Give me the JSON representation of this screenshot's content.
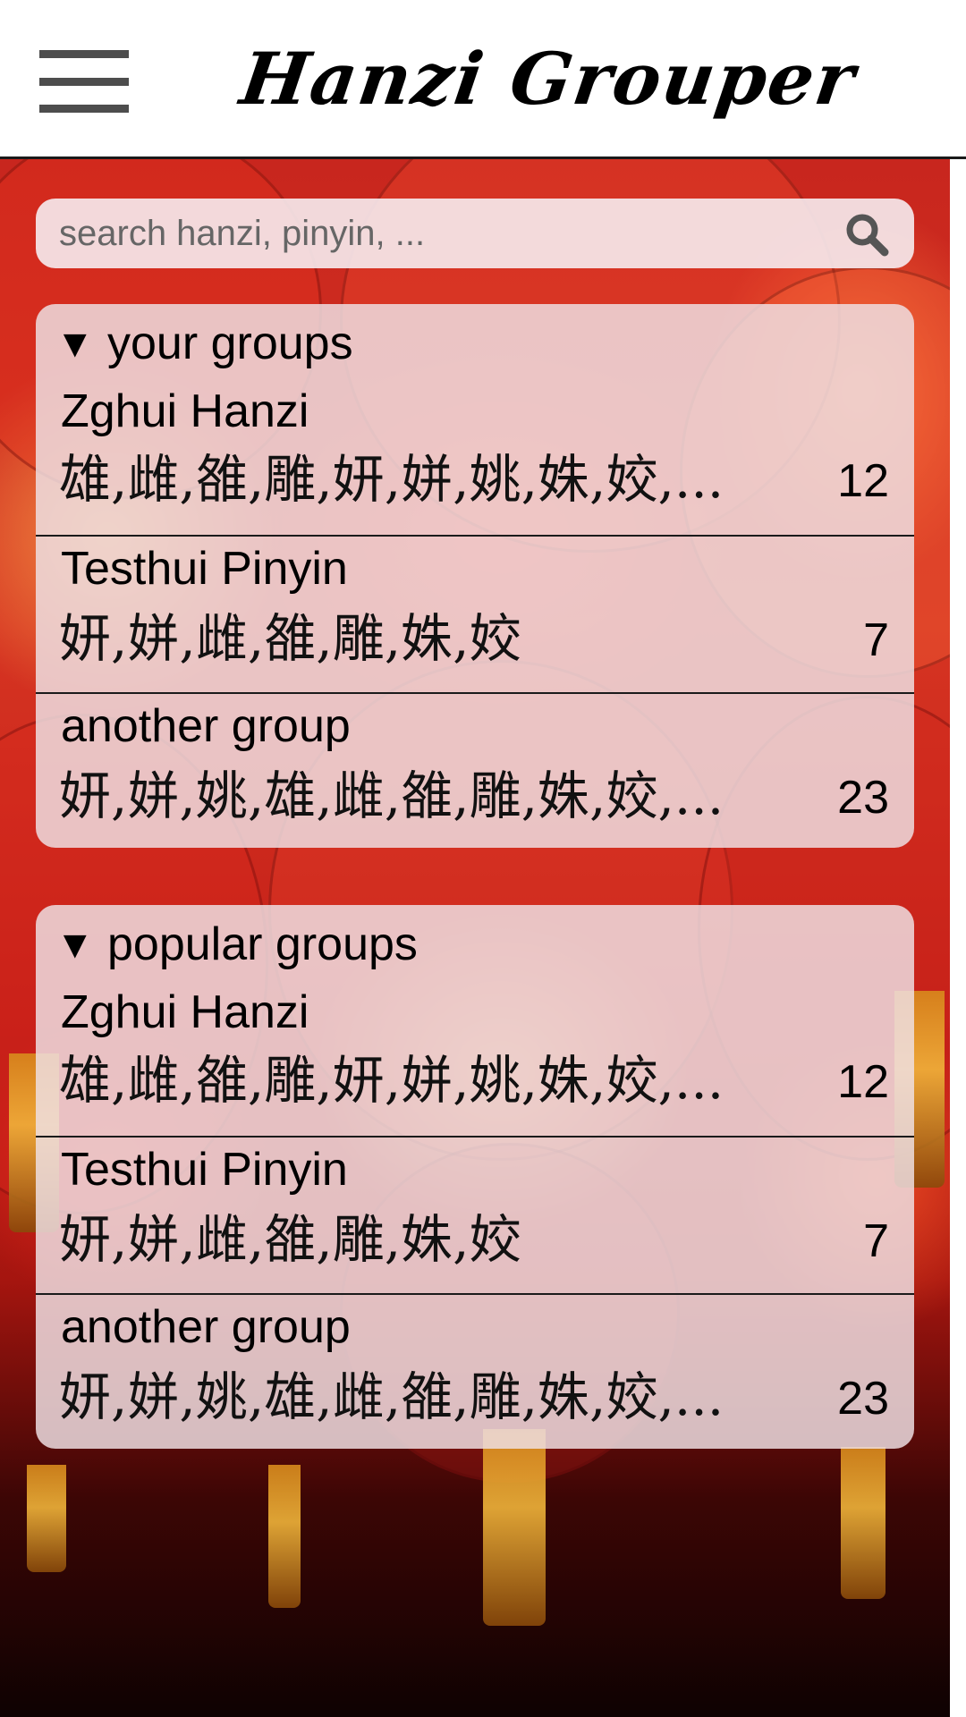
{
  "app": {
    "title": "Hanzi Grouper",
    "menu_icon": "hamburger-menu-icon"
  },
  "search": {
    "placeholder": "search hanzi, pinyin, ...",
    "value": "",
    "icon": "search-icon"
  },
  "your_groups": {
    "toggle": "▼",
    "title": "your groups",
    "items": [
      {
        "name": "Zghui Hanzi",
        "hanzi": "雄,雌,雒,雕,妍,姘,姚,姝,姣,...",
        "count": "12"
      },
      {
        "name": "Testhui Pinyin",
        "hanzi": "妍,姘,雌,雒,雕,姝,姣",
        "count": "7"
      },
      {
        "name": "another group",
        "hanzi": "妍,姘,姚,雄,雌,雒,雕,姝,姣,...",
        "count": "23"
      }
    ]
  },
  "popular_groups": {
    "toggle": "▼",
    "title": "popular groups",
    "items": [
      {
        "name": "Zghui Hanzi",
        "hanzi": "雄,雌,雒,雕,妍,姘,姚,姝,姣,...",
        "count": "12"
      },
      {
        "name": "Testhui Pinyin",
        "hanzi": "妍,姘,雌,雒,雕,姝,姣",
        "count": "7"
      },
      {
        "name": "another group",
        "hanzi": "妍,姘,姚,雄,雌,雒,雕,姝,姣,...",
        "count": "23"
      }
    ]
  },
  "colors": {
    "header_bg": "#ffffff",
    "panel_bg": "#eee0e4",
    "background_red": "#c8261e"
  }
}
